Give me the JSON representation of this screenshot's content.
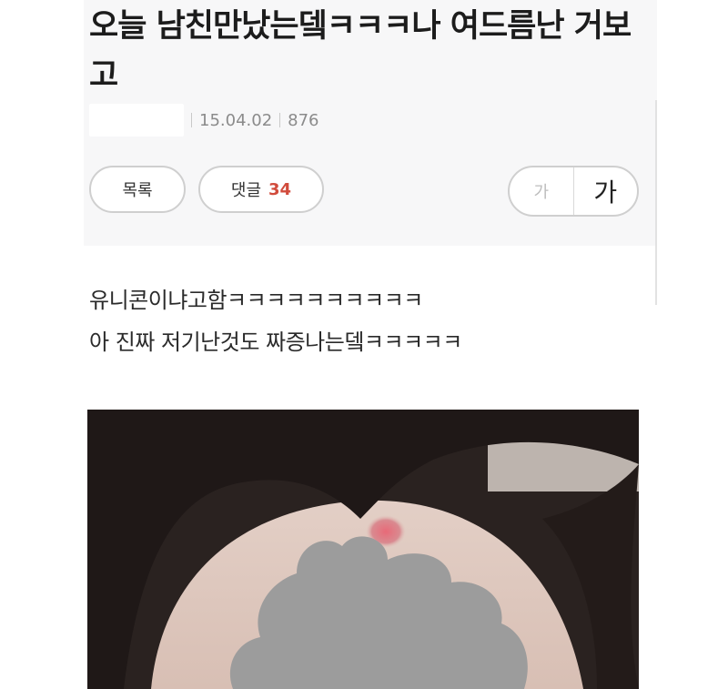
{
  "post": {
    "title": "오늘 남친만났는뎈ㅋㅋㅋ나 여드름난 거보고",
    "date": "15.04.02",
    "views": "876"
  },
  "toolbar": {
    "list_label": "목록",
    "comment_label": "댓글",
    "comment_count": "34",
    "font_small_label": "가",
    "font_large_label": "가"
  },
  "content": {
    "lines": [
      "유니콘이냐고함ㅋㅋㅋㅋㅋㅋㅋㅋㅋㅋ",
      "아 진짜 저기난것도 짜증나는뎈ㅋㅋㅋㅋㅋ"
    ]
  },
  "colors": {
    "comment_count": "#d14b3c",
    "meta_text": "#8b8b8b",
    "card_bg": "#f7f7f8"
  },
  "icons": {
    "photo": "forehead-pimple-photo"
  }
}
